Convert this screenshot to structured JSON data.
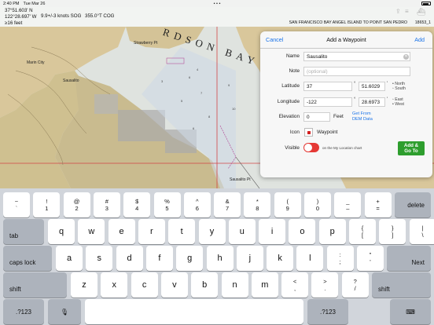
{
  "status_bar": {
    "time": "2:40 PM",
    "date": "Tue Mar 26",
    "dots": "• • •",
    "battery_icon": "battery-icon"
  },
  "nav": {
    "lat": "37°51.603' N",
    "lon": "122°28.697' W",
    "sog": "9.9+/-3 knots SOG",
    "cog": "355.0°T COG",
    "depth": "≥16 feet",
    "chart_name": "SAN FRANCISCO BAY  ANGEL ISLAND TO POINT SAN PEDRO",
    "chart_number": "18653_1"
  },
  "map": {
    "bay_label": "RDSON BAY",
    "marin_city": "Marin City",
    "sausalito": "Sausalito",
    "sausalito_pt": "Sausalito Pt",
    "strawberry": "Strawberry Pt"
  },
  "panel": {
    "cancel": "Cancel",
    "title": "Add a Waypoint",
    "add": "Add",
    "name_label": "Name",
    "name_value": "Sausalito",
    "note_label": "Note",
    "note_placeholder": "(optional)",
    "lat_label": "Latitude",
    "lat_deg": "37",
    "lat_min": "51.6029",
    "north": "North",
    "south": "South",
    "lon_label": "Longitude",
    "lon_deg": "-122",
    "lon_min": "28.6973",
    "east": "East",
    "west": "West",
    "elev_label": "Elevation",
    "elev_value": "0",
    "elev_unit": "Feet",
    "get_from": "Get From",
    "dem_data": "DEM Data",
    "icon_label": "Icon",
    "icon_name": "Waypoint",
    "visible_label": "Visible",
    "visible_note": "on the My Location chart",
    "goto_line1": "Add &",
    "goto_line2": "Go To",
    "degree": "°",
    "minute": "'"
  },
  "keyboard": {
    "row1": [
      {
        "top": "~",
        "bottom": "`"
      },
      {
        "top": "!",
        "bottom": "1"
      },
      {
        "top": "@",
        "bottom": "2"
      },
      {
        "top": "#",
        "bottom": "3"
      },
      {
        "top": "$",
        "bottom": "4"
      },
      {
        "top": "%",
        "bottom": "5"
      },
      {
        "top": "^",
        "bottom": "6"
      },
      {
        "top": "&",
        "bottom": "7"
      },
      {
        "top": "*",
        "bottom": "8"
      },
      {
        "top": "(",
        "bottom": "9"
      },
      {
        "top": ")",
        "bottom": "0"
      },
      {
        "top": "_",
        "bottom": "–"
      },
      {
        "top": "+",
        "bottom": "="
      }
    ],
    "delete": "delete",
    "tab": "tab",
    "row2": [
      "q",
      "w",
      "e",
      "r",
      "t",
      "y",
      "u",
      "i",
      "o",
      "p"
    ],
    "row2_extra": [
      {
        "top": "{",
        "bottom": "["
      },
      {
        "top": "}",
        "bottom": "]"
      },
      {
        "top": "|",
        "bottom": "\\"
      }
    ],
    "caps": "caps lock",
    "row3": [
      "a",
      "s",
      "d",
      "f",
      "g",
      "h",
      "j",
      "k",
      "l"
    ],
    "row3_extra": [
      {
        "top": ":",
        "bottom": ";"
      },
      {
        "top": "\"",
        "bottom": "'"
      }
    ],
    "next": "Next",
    "shift": "shift",
    "row4": [
      "z",
      "x",
      "c",
      "v",
      "b",
      "n",
      "m"
    ],
    "row4_extra": [
      {
        "top": "<",
        "bottom": ","
      },
      {
        "top": ">",
        "bottom": "."
      },
      {
        "top": "?",
        "bottom": "/"
      }
    ],
    "num": ".?123",
    "mic_icon": "microphone-icon",
    "dismiss_icon": "keyboard-dismiss-icon"
  }
}
